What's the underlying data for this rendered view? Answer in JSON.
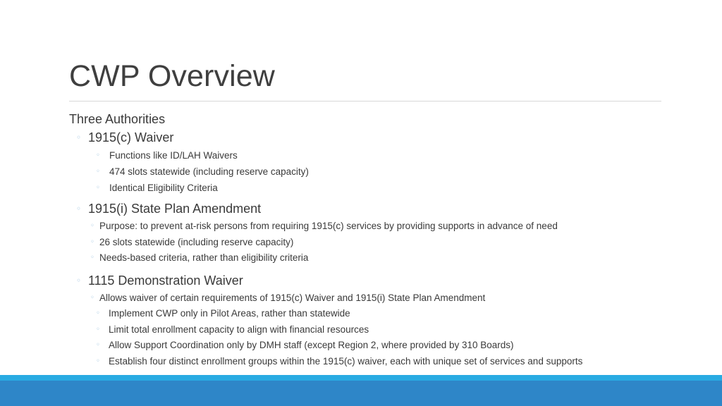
{
  "slide": {
    "title": "CWP Overview",
    "bullet_glyph": "◦",
    "colors": {
      "title_text": "#3f3f3f",
      "body_text": "#3a3a3a",
      "bullet": "#9fc5e0",
      "rule": "#d8d8d8",
      "band_cyan": "#29abe2",
      "band_blue": "#2e86c8",
      "background": "#ffffff"
    },
    "content": {
      "heading": "Three Authorities",
      "sections": [
        {
          "label": "1915(c) Waiver",
          "children": [
            {
              "text": "Functions like ID/LAH Waivers"
            },
            {
              "text": "474 slots statewide (including reserve capacity)"
            },
            {
              "text": "Identical Eligibility Criteria"
            }
          ]
        },
        {
          "label": "1915(i) State Plan Amendment",
          "children": [
            {
              "text": "Purpose: to prevent at-risk persons from requiring 1915(c) services by providing supports in advance of need"
            },
            {
              "text": "26 slots statewide (including reserve capacity)"
            },
            {
              "text": "Needs-based criteria, rather than eligibility criteria"
            }
          ]
        },
        {
          "label": "1115 Demonstration Waiver",
          "children": [
            {
              "text": "Allows waiver of certain requirements of 1915(c) Waiver and 1915(i) State Plan Amendment"
            }
          ],
          "grandchildren": [
            {
              "text": "Implement CWP only in Pilot Areas, rather than statewide"
            },
            {
              "text": "Limit total enrollment capacity to align with financial resources"
            },
            {
              "text": "Allow Support Coordination only by DMH staff (except Region 2, where provided by 310 Boards)"
            },
            {
              "text": "Establish four distinct enrollment groups within the 1915(c) waiver, each with unique set of services and supports"
            }
          ]
        }
      ]
    }
  }
}
